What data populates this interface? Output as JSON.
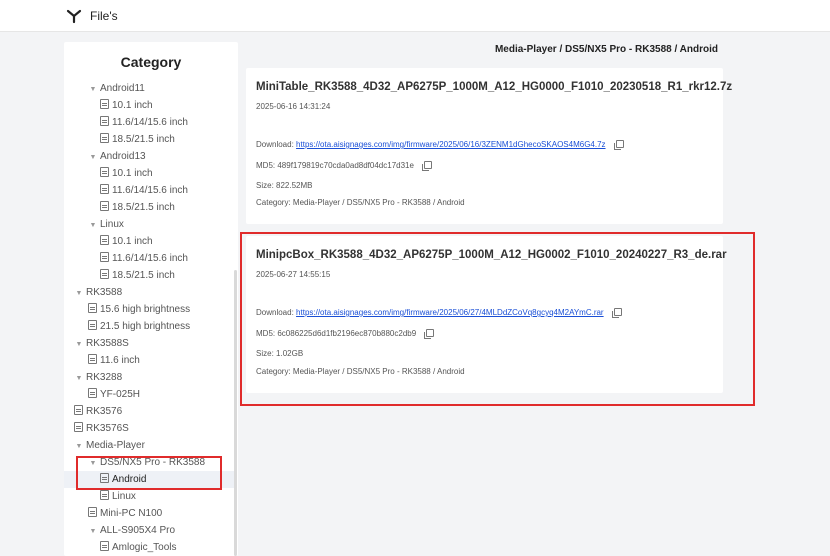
{
  "app": {
    "title": "File's"
  },
  "breadcrumb": "Media-Player / DS5/NX5 Pro - RK3588 / Android",
  "sidebar": {
    "title": "Category",
    "items": [
      {
        "label": "Android11",
        "type": "folder",
        "level": 1
      },
      {
        "label": "10.1 inch",
        "type": "file",
        "level": 2
      },
      {
        "label": "11.6/14/15.6 inch",
        "type": "file",
        "level": 2
      },
      {
        "label": "18.5/21.5 inch",
        "type": "file",
        "level": 2
      },
      {
        "label": "Android13",
        "type": "folder",
        "level": 1
      },
      {
        "label": "10.1 inch",
        "type": "file",
        "level": 2
      },
      {
        "label": "11.6/14/15.6 inch",
        "type": "file",
        "level": 2
      },
      {
        "label": "18.5/21.5 inch",
        "type": "file",
        "level": 2
      },
      {
        "label": "Linux",
        "type": "folder",
        "level": 1
      },
      {
        "label": "10.1 inch",
        "type": "file",
        "level": 2
      },
      {
        "label": "11.6/14/15.6 inch",
        "type": "file",
        "level": 2
      },
      {
        "label": "18.5/21.5 inch",
        "type": "file",
        "level": 2
      },
      {
        "label": "RK3588",
        "type": "folder",
        "level": 0
      },
      {
        "label": "15.6 high brightness",
        "type": "file",
        "level": 1
      },
      {
        "label": "21.5 high brightness",
        "type": "file",
        "level": 1
      },
      {
        "label": "RK3588S",
        "type": "folder",
        "level": 0
      },
      {
        "label": "11.6 inch",
        "type": "file",
        "level": 1
      },
      {
        "label": "RK3288",
        "type": "folder",
        "level": 0
      },
      {
        "label": "YF-025H",
        "type": "file",
        "level": 1
      },
      {
        "label": "RK3576",
        "type": "file",
        "level": 0
      },
      {
        "label": "RK3576S",
        "type": "file",
        "level": 0
      },
      {
        "label": "Media-Player",
        "type": "folder",
        "level": 0
      },
      {
        "label": "DS5/NX5 Pro - RK3588",
        "type": "folder",
        "level": 1
      },
      {
        "label": "Android",
        "type": "file",
        "level": 2,
        "active": true
      },
      {
        "label": "Linux",
        "type": "file",
        "level": 2
      },
      {
        "label": "Mini-PC N100",
        "type": "file",
        "level": 1
      },
      {
        "label": "ALL-S905X4 Pro",
        "type": "folder",
        "level": 1
      },
      {
        "label": "Amlogic_Tools",
        "type": "file",
        "level": 2
      }
    ]
  },
  "files": [
    {
      "title": "MiniTable_RK3588_4D32_AP6275P_1000M_A12_HG0000_F1010_20230518_R1_rkr12.7z",
      "date": "2025-06-16 14:31:24",
      "download_label": "Download:",
      "download_url": "https://ota.aisignages.com/img/firmware/2025/06/16/3ZENM1dGhecoSKAOS4M6G4.7z",
      "md5_label": "MD5:",
      "md5": "489f179819c70cda0ad8df04dc17d31e",
      "size_label": "Size:",
      "size": "822.52MB",
      "category_label": "Category:",
      "category": "Media-Player / DS5/NX5 Pro - RK3588 / Android"
    },
    {
      "title": "MinipcBox_RK3588_4D32_AP6275P_1000M_A12_HG0002_F1010_20240227_R3_de.rar",
      "date": "2025-06-27 14:55:15",
      "download_label": "Download:",
      "download_url": "https://ota.aisignages.com/img/firmware/2025/06/27/4MLDdZCoVq8gcyq4M2AYmC.rar",
      "md5_label": "MD5:",
      "md5": "6c086225d6d1fb2196ec870b880c2db9",
      "size_label": "Size:",
      "size": "1.02GB",
      "category_label": "Category:",
      "category": "Media-Player / DS5/NX5 Pro - RK3588 / Android"
    }
  ],
  "colors": {
    "link": "#1a4fd6",
    "highlight": "#e02b2b",
    "active_row": "#eef1f6"
  }
}
